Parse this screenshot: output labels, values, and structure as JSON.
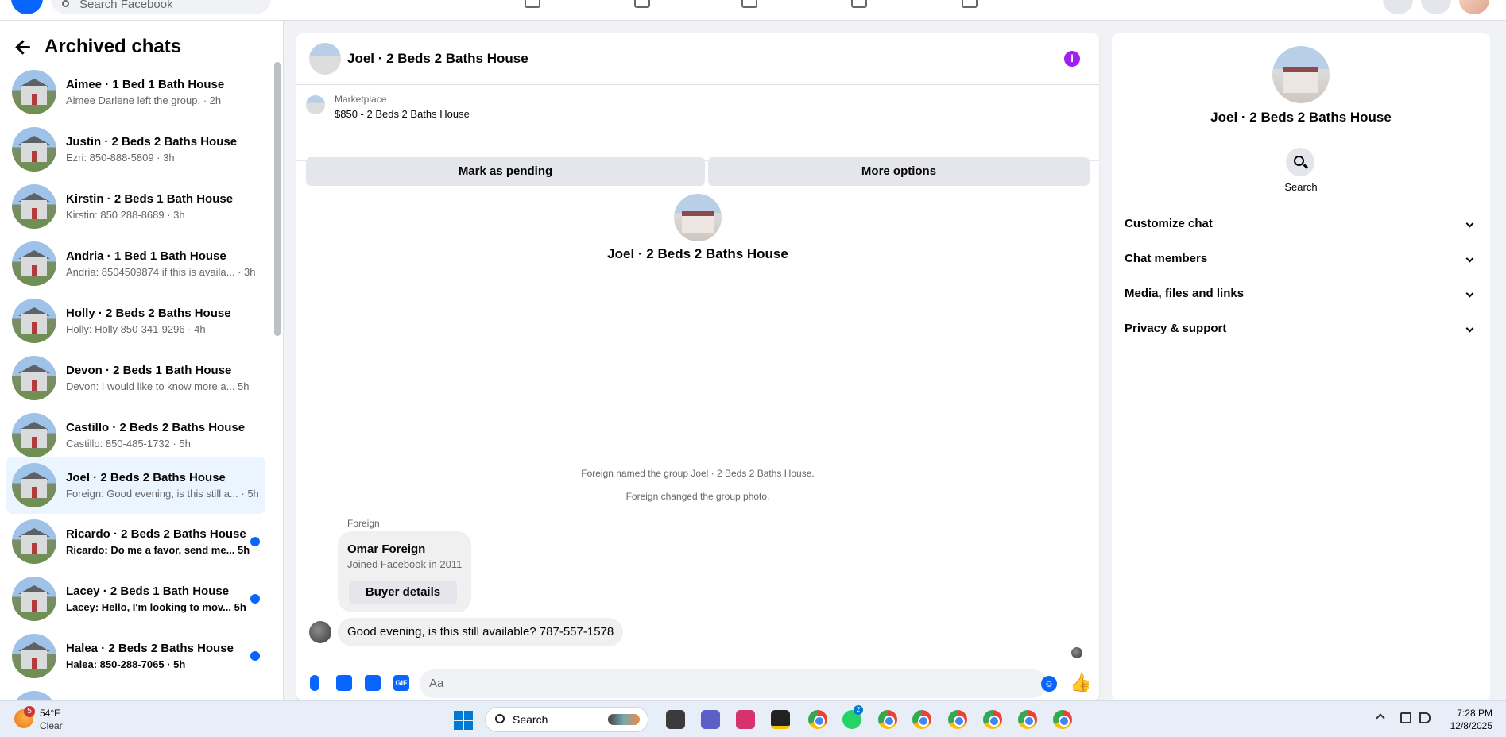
{
  "topbar": {
    "search_placeholder": "Search Facebook"
  },
  "sidebar": {
    "title": "Archived chats",
    "chats": [
      {
        "title": "Aimee · 1 Bed 1 Bath House",
        "preview": "Aimee Darlene left the group. · 2h",
        "unread": false,
        "selected": false
      },
      {
        "title": "Justin · 2 Beds 2 Baths House",
        "preview": "Ezri: 850-888-5809 · 3h",
        "unread": false,
        "selected": false
      },
      {
        "title": "Kirstin · 2 Beds 1 Bath House",
        "preview": "Kirstin: 850 288-8689 · 3h",
        "unread": false,
        "selected": false
      },
      {
        "title": "Andria · 1 Bed 1 Bath House",
        "preview": "Andria: 8504509874 if this is availa... · 3h",
        "unread": false,
        "selected": false
      },
      {
        "title": "Holly · 2 Beds 2 Baths House",
        "preview": "Holly: Holly 850-341-9296 · 4h",
        "unread": false,
        "selected": false
      },
      {
        "title": "Devon · 2 Beds 1 Bath House",
        "preview": "Devon: I would like to know more a... 5h",
        "unread": false,
        "selected": false
      },
      {
        "title": "Castillo · 2 Beds 2 Baths House",
        "preview": "Castillo: 850-485-1732 · 5h",
        "unread": false,
        "selected": false
      },
      {
        "title": "Joel · 2 Beds 2 Baths House",
        "preview": "Foreign: Good evening, is this still a... · 5h",
        "unread": false,
        "selected": true
      },
      {
        "title": "Ricardo · 2 Beds 2 Baths House",
        "preview": "Ricardo: Do me a favor, send me... 5h",
        "unread": true,
        "selected": false
      },
      {
        "title": "Lacey · 2 Beds 1 Bath House",
        "preview": "Lacey: Hello, I'm looking to mov... 5h",
        "unread": true,
        "selected": false
      },
      {
        "title": "Halea · 2 Beds 2 Baths House",
        "preview": "Halea: 850-288-7065 · 5h",
        "unread": true,
        "selected": false
      }
    ]
  },
  "conversation": {
    "title": "Joel · 2 Beds 2 Baths House",
    "marketplace_label": "Marketplace",
    "listing": "$850 - 2 Beds 2 Baths House",
    "mark_pending": "Mark as pending",
    "more_options": "More options",
    "group_name": "Joel · 2 Beds 2 Baths House",
    "system_messages": [
      "Foreign named the group Joel · 2 Beds 2 Baths House.",
      "Foreign changed the group photo."
    ],
    "sender_name": "Foreign",
    "buyer_card": {
      "name": "Omar Foreign",
      "joined": "Joined Facebook in 2011",
      "button": "Buyer details"
    },
    "message": "Good evening, is this still available? 787-557-1578",
    "composer_placeholder": "Aa",
    "gif_label": "GIF"
  },
  "details_panel": {
    "name": "Joel · 2 Beds 2 Baths House",
    "search_label": "Search",
    "sections": [
      "Customize chat",
      "Chat members",
      "Media, files and links",
      "Privacy & support"
    ]
  },
  "taskbar": {
    "temperature": "54°F",
    "condition": "Clear",
    "weather_badge": "5",
    "search_label": "Search",
    "whatsapp_badge": "2",
    "time": "7:28 PM",
    "date": "12/8/2025"
  },
  "colors": {
    "accent_blue": "#0866ff",
    "info_purple": "#a020f0",
    "selected_bg": "#ebf5ff"
  }
}
